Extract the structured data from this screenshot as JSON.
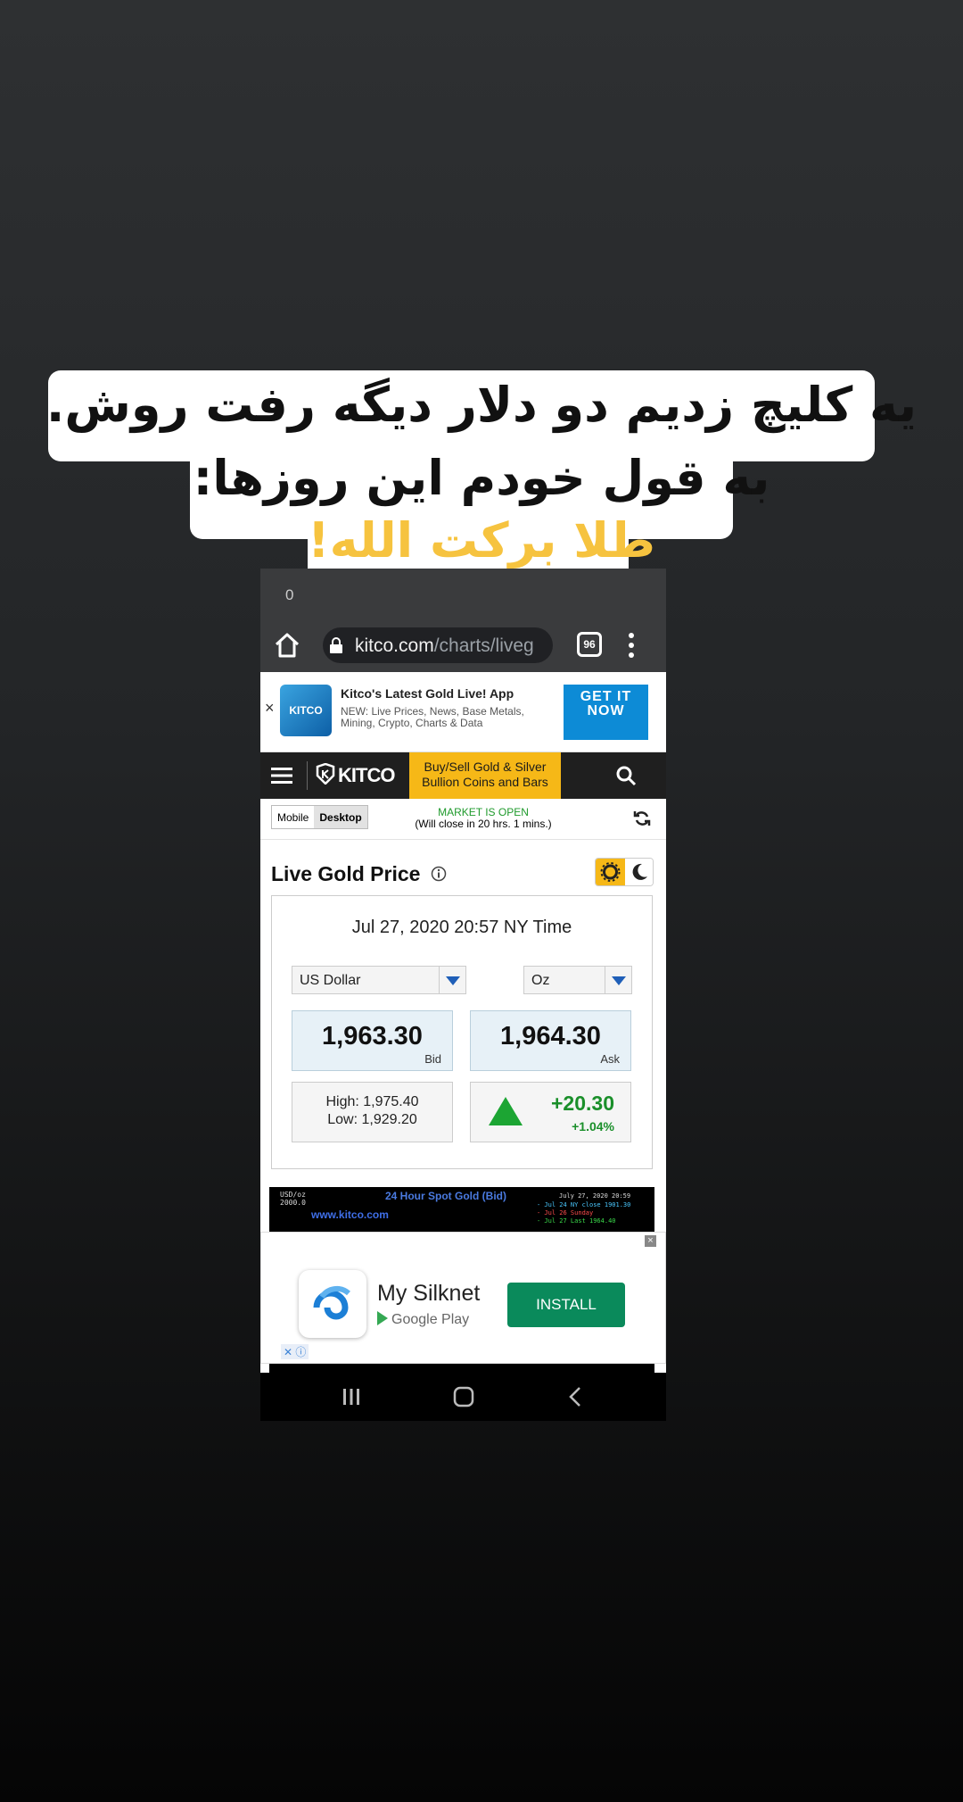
{
  "overlay": {
    "caption_line1": "یه کلیچ زدیم دو دلار دیگه رفت روش.",
    "caption_line2": "به قول خودم این روزها:",
    "caption_line3": "طلا برکت الله!",
    "highlight_color": "#f6c33f"
  },
  "status_bar": {
    "time": "0"
  },
  "browser": {
    "url_host": "kitco.com",
    "url_path": "/charts/liveg",
    "tab_count": "96",
    "icons": [
      "home-icon",
      "lock-icon",
      "tabs-icon",
      "more-vert-icon"
    ]
  },
  "top_ad": {
    "close": "×",
    "logo_text": "KITCO",
    "title": "Kitco's Latest Gold Live! App",
    "description": "NEW: Live Prices, News, Base Metals, Mining, Crypto, Charts & Data",
    "cta": "GET IT NOW"
  },
  "site_nav": {
    "logo": "KITCO",
    "promo_line1": "Buy/Sell Gold & Silver",
    "promo_line2": "Bullion Coins and Bars",
    "icons": [
      "menu-icon",
      "search-icon"
    ]
  },
  "view_toggle": {
    "mobile": "Mobile",
    "desktop": "Desktop",
    "selected": "Desktop"
  },
  "market": {
    "status": "MARKET IS OPEN",
    "close_note": "(Will close in 20 hrs. 1 mins.)"
  },
  "live_price": {
    "title": "Live Gold Price",
    "timestamp": "Jul 27, 2020 20:57 NY Time",
    "currency": "US Dollar",
    "unit": "Oz",
    "bid": "1,963.30",
    "bid_label": "Bid",
    "ask": "1,964.30",
    "ask_label": "Ask",
    "high": "High: 1,975.40",
    "low": "Low: 1,929.20",
    "change": "+20.30",
    "change_pct": "+1.04%",
    "up_color": "#1ca533"
  },
  "chart_strip": {
    "unit": "USD/oz",
    "level": "2000.0",
    "title": "24 Hour Spot Gold (Bid)",
    "site": "www.kitco.com",
    "date": "July 27, 2020 20:59",
    "legend": [
      "- Jul 24 NY close 1901.30",
      "- Jul 26 Sunday",
      "- Jul 27 Last 1964.40"
    ],
    "legend_colors": [
      "#4ac8ff",
      "#ff4d4d",
      "#3ad94a"
    ]
  },
  "bottom_ad": {
    "close": "×",
    "app_name": "My Silknet",
    "store": "Google Play",
    "cta": "INSTALL",
    "ad_choices": "✕ ⓘ"
  }
}
